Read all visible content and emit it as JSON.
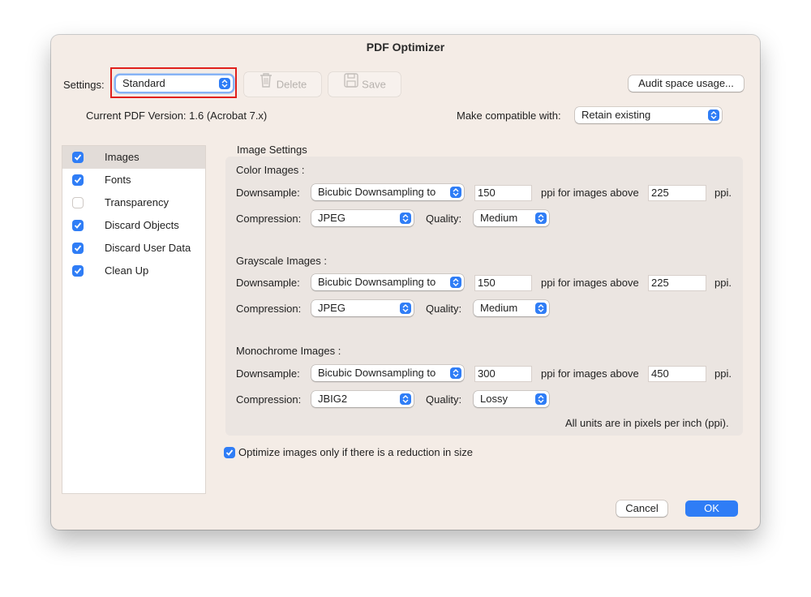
{
  "window": {
    "title": "PDF Optimizer"
  },
  "toolbar": {
    "settings_label": "Settings:",
    "settings_value": "Standard",
    "delete_label": "Delete",
    "save_label": "Save",
    "audit_label": "Audit space usage..."
  },
  "version": {
    "current_text": "Current PDF Version: 1.6 (Acrobat 7.x)",
    "compat_label": "Make compatible with:",
    "compat_value": "Retain existing"
  },
  "sidebar": {
    "items": [
      {
        "label": "Images",
        "checked": true,
        "selected": true
      },
      {
        "label": "Fonts",
        "checked": true
      },
      {
        "label": "Transparency",
        "checked": false
      },
      {
        "label": "Discard Objects",
        "checked": true
      },
      {
        "label": "Discard User Data",
        "checked": true
      },
      {
        "label": "Clean Up",
        "checked": true
      }
    ]
  },
  "image_settings": {
    "title": "Image Settings",
    "downsample_label": "Downsample:",
    "compression_label": "Compression:",
    "quality_label": "Quality:",
    "ppi_above_label": "ppi for images above",
    "ppi_unit": "ppi.",
    "color": {
      "heading": "Color Images :",
      "downsample": "Bicubic Downsampling to",
      "ppi": "150",
      "above": "225",
      "compression": "JPEG",
      "quality": "Medium"
    },
    "grayscale": {
      "heading": "Grayscale Images :",
      "downsample": "Bicubic Downsampling to",
      "ppi": "150",
      "above": "225",
      "compression": "JPEG",
      "quality": "Medium"
    },
    "mono": {
      "heading": "Monochrome Images :",
      "downsample": "Bicubic Downsampling to",
      "ppi": "300",
      "above": "450",
      "compression": "JBIG2",
      "quality": "Lossy"
    },
    "units_note": "All units are in pixels per inch (ppi)."
  },
  "optimize_only": {
    "label": "Optimize images only if there is a reduction in size",
    "checked": true
  },
  "footer": {
    "cancel_label": "Cancel",
    "ok_label": "OK"
  },
  "colors": {
    "accent": "#2f7df6",
    "highlight": "#e0201c",
    "window_bg": "#f4ece6"
  }
}
